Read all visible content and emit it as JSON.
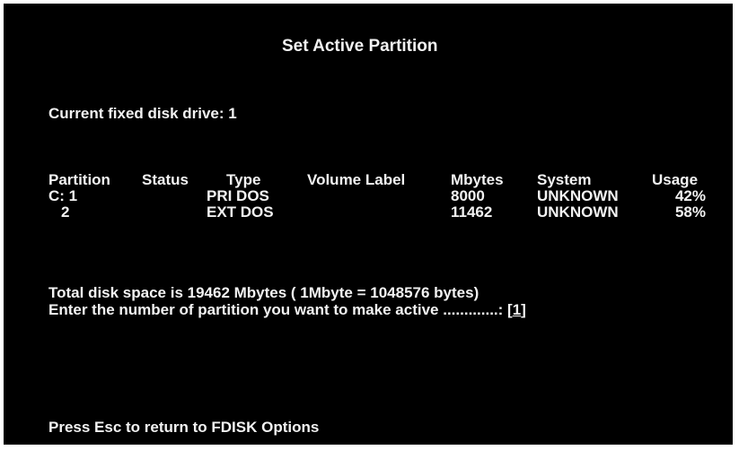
{
  "screen": {
    "title": "Set Active Partition",
    "current_drive_label": "Current fixed disk drive: 1",
    "table": {
      "headers": {
        "partition": "Partition",
        "status": "Status",
        "type": "Type",
        "volume_label": "Volume Label",
        "mbytes": "Mbytes",
        "system": "System",
        "usage": "Usage"
      },
      "rows": [
        {
          "partition": "C: 1",
          "status": "",
          "type": "PRI DOS",
          "volume_label": "",
          "mbytes": "8000",
          "system": "UNKNOWN",
          "usage": "42%"
        },
        {
          "partition": "2",
          "status": "",
          "type": "EXT DOS",
          "volume_label": "",
          "mbytes": "11462",
          "system": "UNKNOWN",
          "usage": "58%"
        }
      ]
    },
    "total_space": "Total disk space is 19462 Mbytes ( 1Mbyte = 1048576 bytes)",
    "prompt": {
      "text": "Enter the number of partition you want to make active .............: [",
      "value": "1",
      "close": "]"
    },
    "footer": "Press Esc to return to FDISK Options"
  }
}
